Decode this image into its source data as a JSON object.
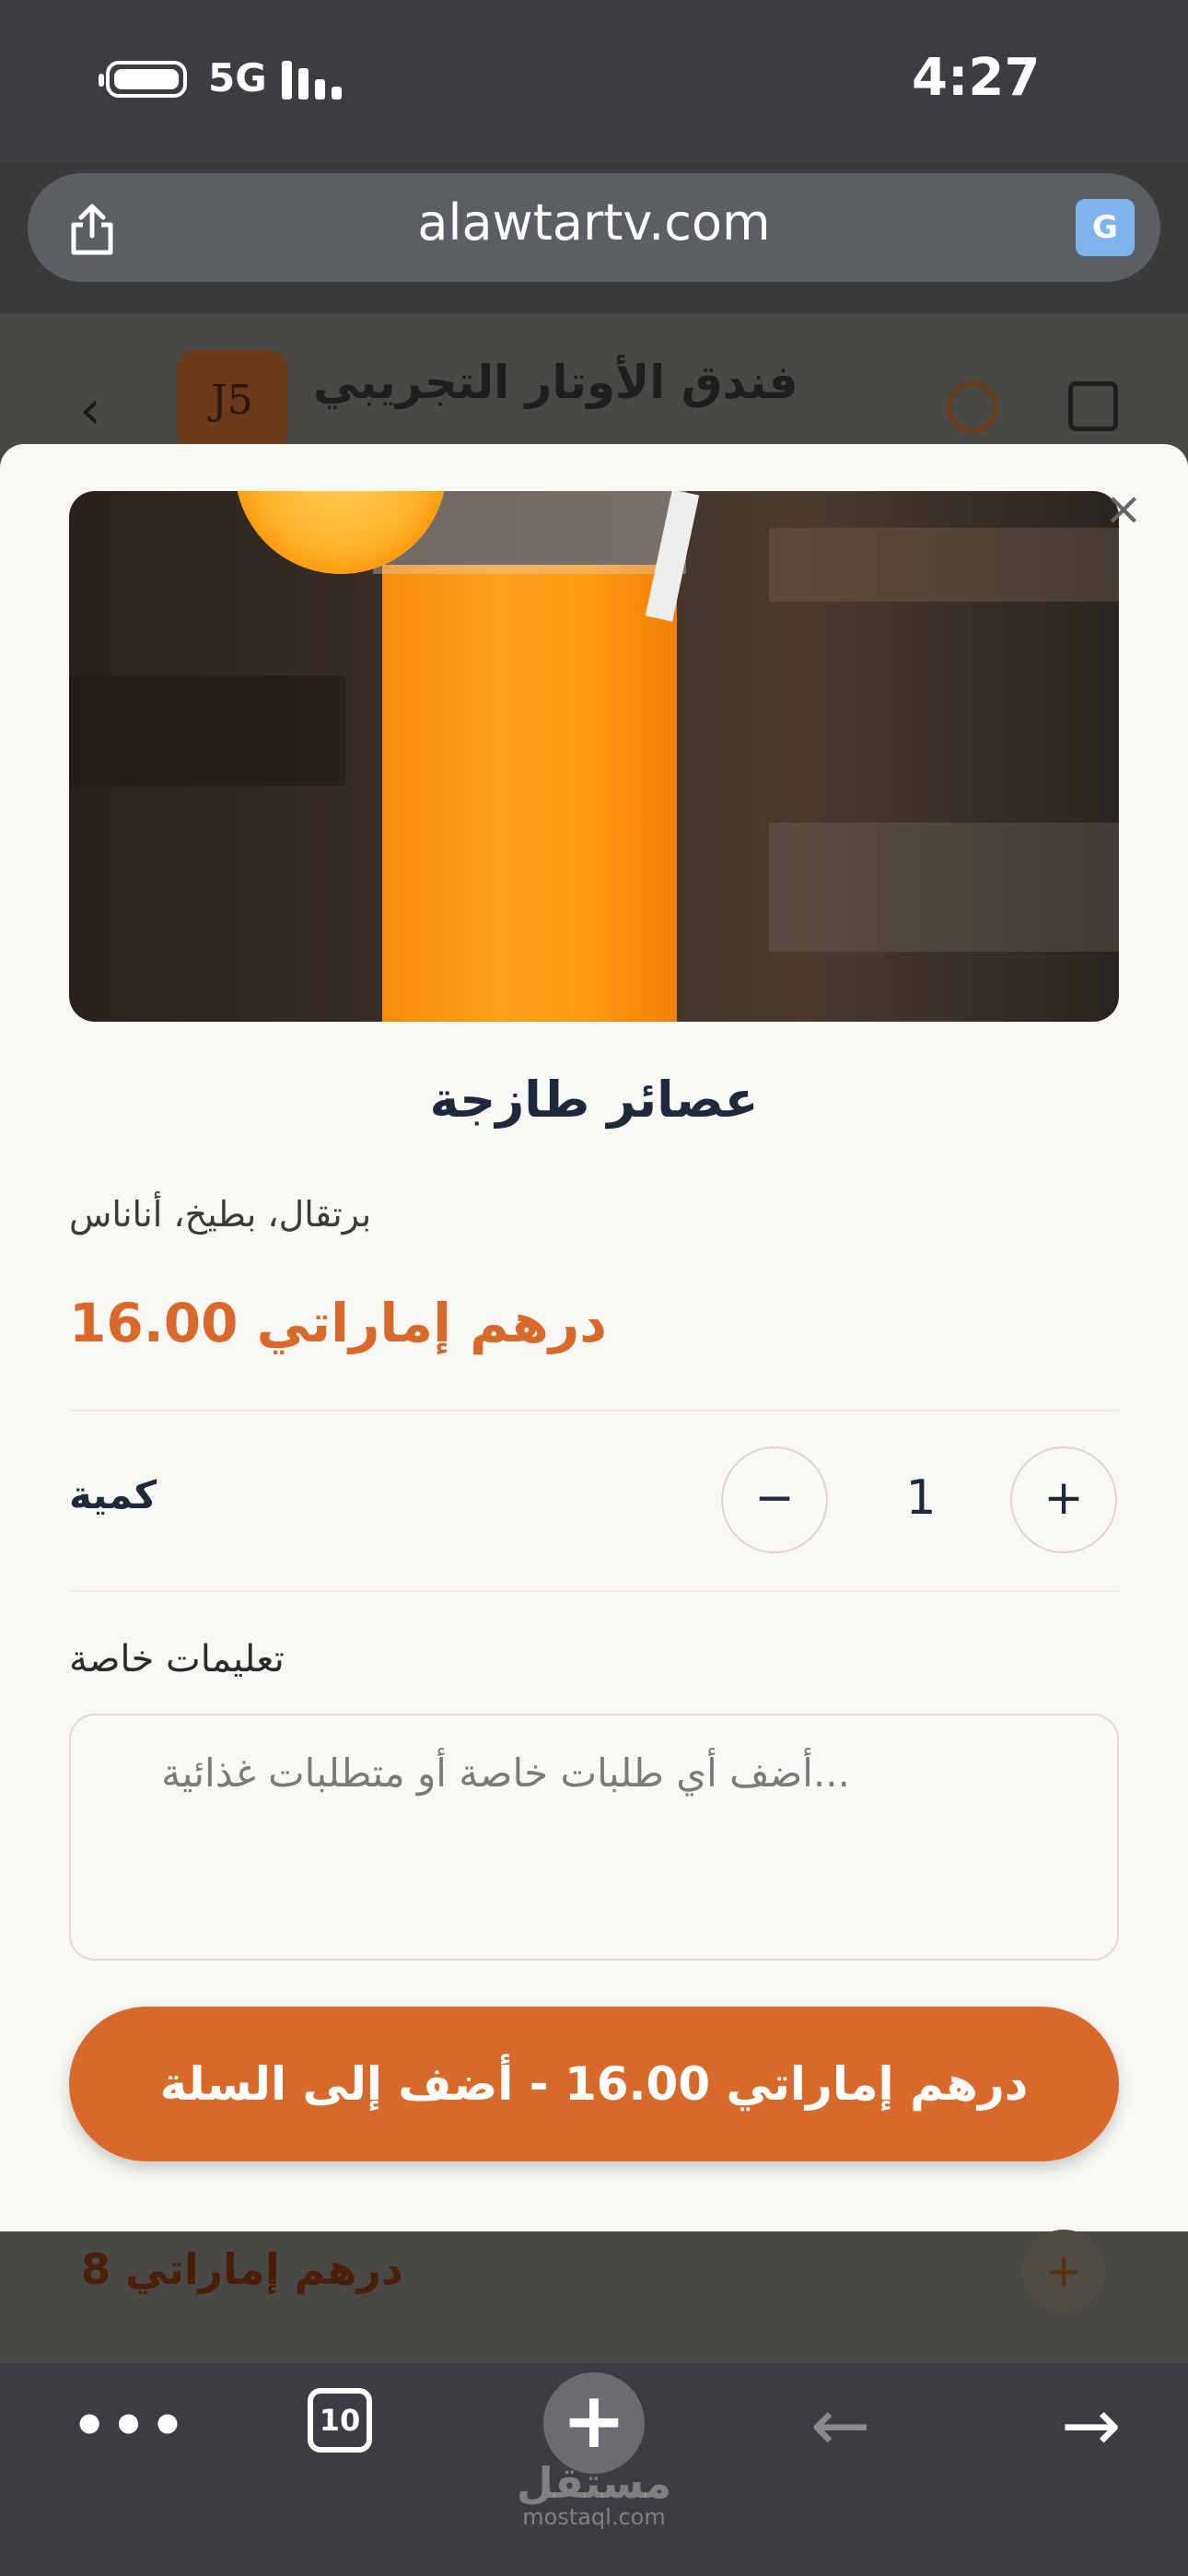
{
  "status_bar": {
    "network": "5G",
    "time": "4:27"
  },
  "browser": {
    "url": "alawtartv.com",
    "share_icon": "share-icon",
    "translate_icon": "translate-icon"
  },
  "background_page": {
    "back_icon": "chevron-left-icon",
    "logo_text": "J5",
    "title": "فندق الأوتار التجريبي",
    "item_price": "درهم إماراتي 8"
  },
  "modal": {
    "close_icon": "close-icon",
    "product_name": "عصائر طازجة",
    "product_description": "برتقال، بطيخ، أناناس",
    "price": "درهم إماراتي 16.00",
    "quantity_label": "كمية",
    "quantity_value": "1",
    "decrement_label": "−",
    "increment_label": "+",
    "instructions_label": "تعليمات خاصة",
    "instructions_placeholder": "...أضف أي طلبات خاصة أو متطلبات غذائية",
    "add_to_cart_label": "درهم إماراتي  16.00  -  أضف إلى السلة"
  },
  "toolbar": {
    "more_label": "•••",
    "tab_count": "10",
    "new_tab_label": "+",
    "back_icon": "arrow-left-icon",
    "forward_icon": "arrow-right-icon"
  },
  "watermark": {
    "arabic": "مستقل",
    "latin": "mostaql.com"
  },
  "colors": {
    "accent": "#d76a2b",
    "text_dark": "#1e2a3a",
    "sheet_bg": "#faf8f5",
    "chrome_bg": "#3b3d40"
  }
}
